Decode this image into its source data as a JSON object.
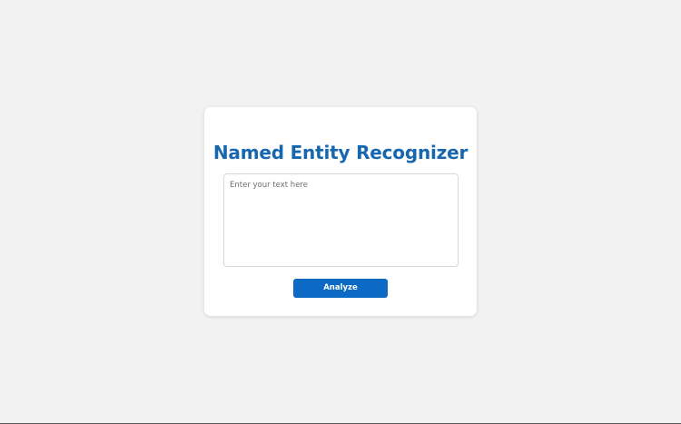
{
  "app": {
    "title": "Named Entity Recognizer"
  },
  "form": {
    "text_input": {
      "value": "",
      "placeholder": "Enter your text here"
    },
    "analyze_label": "Analyze"
  },
  "colors": {
    "background": "#f2f2f2",
    "card": "#ffffff",
    "title": "#1667b0",
    "button": "#0c6ac4",
    "button_text": "#ffffff"
  }
}
